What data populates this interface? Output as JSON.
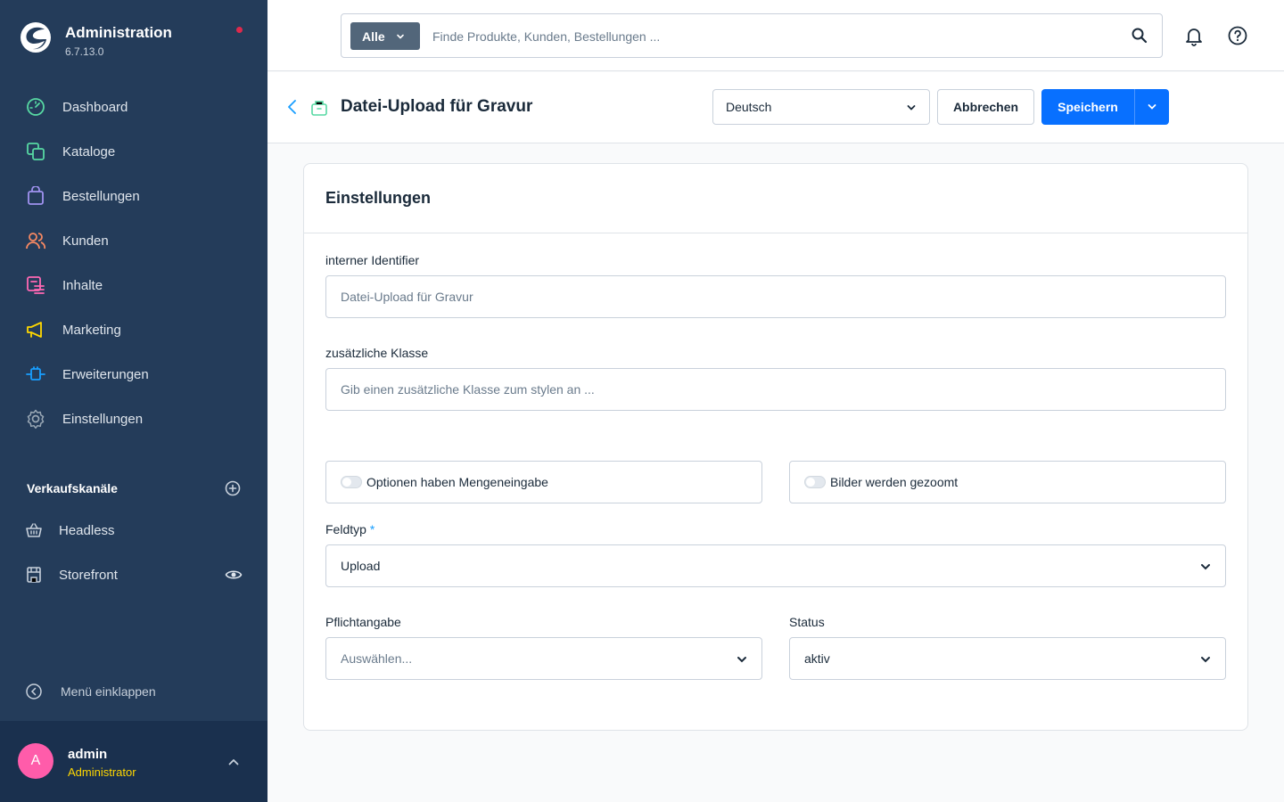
{
  "brand": {
    "title": "Administration",
    "version": "6.7.13.0"
  },
  "nav": [
    {
      "label": "Dashboard",
      "icon": "dashboard-icon",
      "color": "#57d9a3"
    },
    {
      "label": "Kataloge",
      "icon": "catalog-icon",
      "color": "#57d9a3"
    },
    {
      "label": "Bestellungen",
      "icon": "orders-icon",
      "color": "#a092f0"
    },
    {
      "label": "Kunden",
      "icon": "customers-icon",
      "color": "#f88962"
    },
    {
      "label": "Inhalte",
      "icon": "content-icon",
      "color": "#ff68b4"
    },
    {
      "label": "Marketing",
      "icon": "marketing-icon",
      "color": "#ffd700"
    },
    {
      "label": "Erweiterungen",
      "icon": "extensions-icon",
      "color": "#189eff"
    },
    {
      "label": "Einstellungen",
      "icon": "settings-icon",
      "color": "#9aa8b5"
    }
  ],
  "sales_channels": {
    "title": "Verkaufskanäle",
    "items": [
      {
        "label": "Headless"
      },
      {
        "label": "Storefront"
      }
    ]
  },
  "collapse_label": "Menü einklappen",
  "user": {
    "initial": "A",
    "name": "admin",
    "role": "Administrator"
  },
  "search": {
    "type_label": "Alle",
    "placeholder": "Finde Produkte, Kunden, Bestellungen ..."
  },
  "page": {
    "title": "Datei-Upload für Gravur"
  },
  "language": {
    "selected": "Deutsch"
  },
  "actions": {
    "cancel": "Abbrechen",
    "save": "Speichern"
  },
  "card": {
    "title": "Einstellungen",
    "identifier": {
      "label": "interner Identifier",
      "value": "",
      "placeholder": "Datei-Upload für Gravur"
    },
    "css_class": {
      "label": "zusätzliche Klasse",
      "value": "",
      "placeholder": "Gib einen zusätzliche Klasse zum stylen an ..."
    },
    "quantity_switch": {
      "label": "Optionen haben Mengeneingabe",
      "checked": false
    },
    "zoom_switch": {
      "label": "Bilder werden gezoomt",
      "checked": false
    },
    "field_type": {
      "label": "Feldtyp",
      "required_mark": "*",
      "selected": "Upload"
    },
    "required": {
      "label": "Pflichtangabe",
      "placeholder": "Auswählen..."
    },
    "status": {
      "label": "Status",
      "selected": "aktiv"
    }
  },
  "colors": {
    "sidebar": "#243c5a",
    "primary": "#0870ff",
    "user_bar": "#1a304e",
    "avatar": "#ff5caa"
  }
}
